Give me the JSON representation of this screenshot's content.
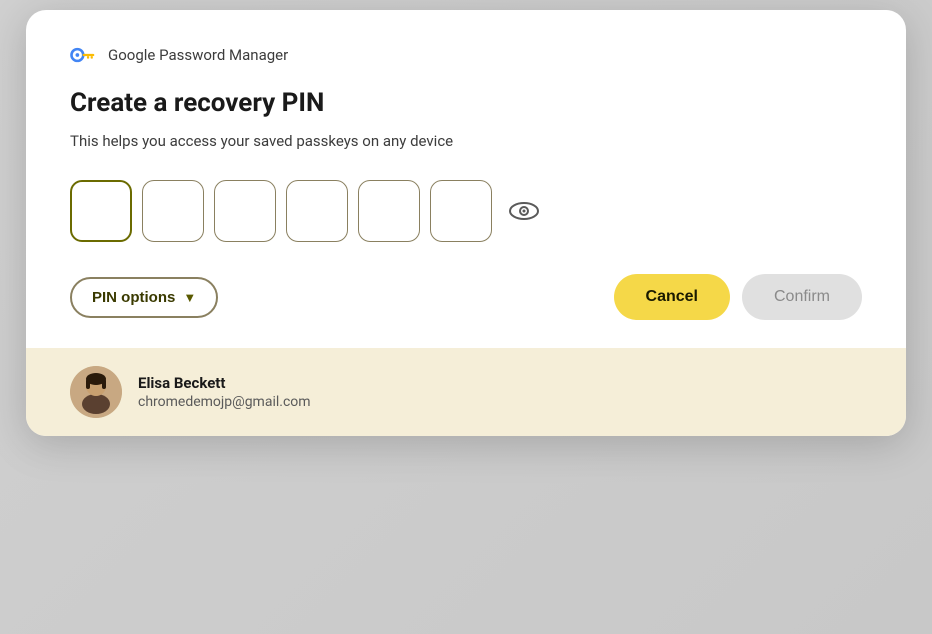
{
  "modal": {
    "brand": "Google Password Manager",
    "title": "Create a recovery PIN",
    "subtitle": "This helps you access your saved passkeys on any device",
    "pin_boxes": [
      "",
      "",
      "",
      "",
      "",
      ""
    ],
    "actions": {
      "pin_options_label": "PIN options",
      "cancel_label": "Cancel",
      "confirm_label": "Confirm"
    }
  },
  "user": {
    "name": "Elisa Beckett",
    "email": "chromedemojp@gmail.com"
  },
  "colors": {
    "pin_border_active": "#6b6b00",
    "pin_border_inactive": "#8a8060",
    "cancel_bg": "#f5d848",
    "confirm_bg": "#e0e0e0",
    "footer_bg": "#f5eed8"
  }
}
